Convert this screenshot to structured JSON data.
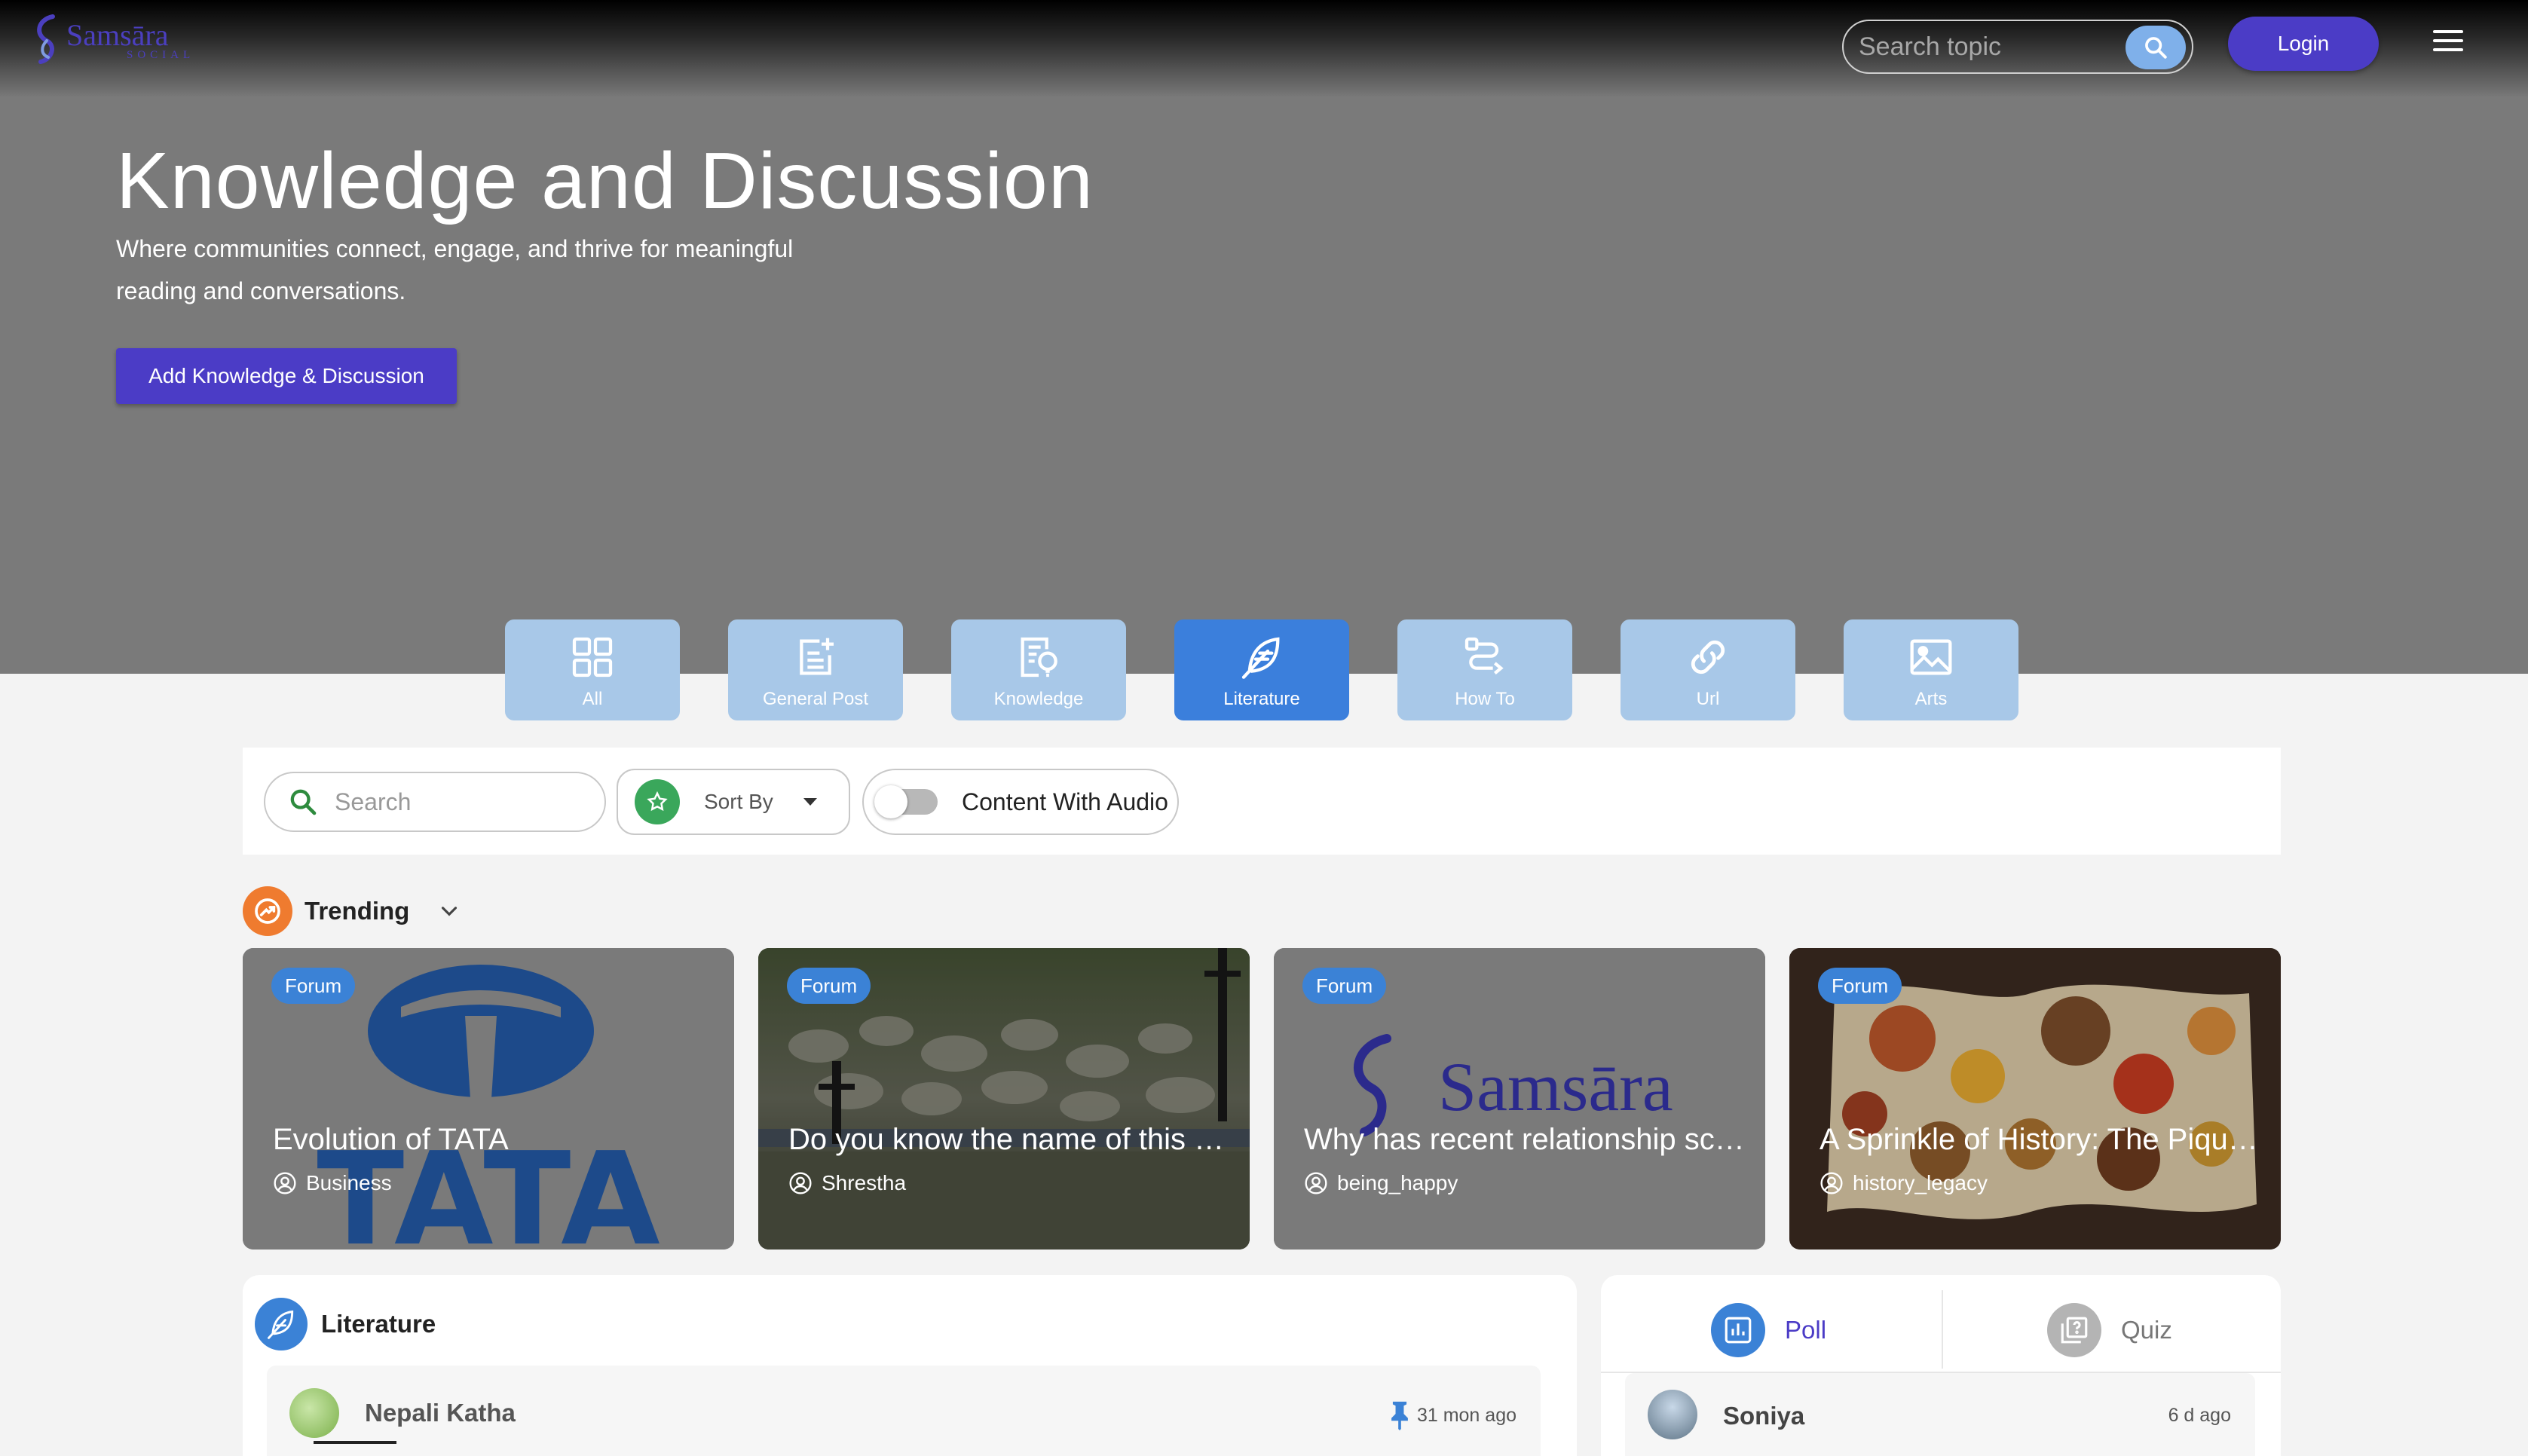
{
  "header": {
    "logo_text": "Samsāra",
    "logo_sub": "SOCIAL",
    "search_placeholder": "Search topic",
    "login_label": "Login"
  },
  "hero": {
    "title": "Knowledge and Discussion",
    "subtitle": "Where communities connect, engage, and thrive for meaningful reading and conversations.",
    "cta_label": "Add Knowledge & Discussion"
  },
  "categories": [
    {
      "label": "All",
      "icon": "grid-icon",
      "active": false
    },
    {
      "label": "General Post",
      "icon": "edit-document-icon",
      "active": false
    },
    {
      "label": "Knowledge",
      "icon": "knowledge-document-icon",
      "active": false
    },
    {
      "label": "Literature",
      "icon": "feather-icon",
      "active": true
    },
    {
      "label": "How To",
      "icon": "route-icon",
      "active": false
    },
    {
      "label": "Url",
      "icon": "link-icon",
      "active": false
    },
    {
      "label": "Arts",
      "icon": "image-icon",
      "active": false
    }
  ],
  "filters": {
    "search_placeholder": "Search",
    "sort_label": "Sort By",
    "audio_label": "Content With Audio",
    "audio_enabled": false
  },
  "trending": {
    "label": "Trending",
    "cards": [
      {
        "badge": "Forum",
        "title": "Evolution of TATA",
        "author": "Business",
        "image": "tata-logo"
      },
      {
        "badge": "Forum",
        "title": "Do you know the name of this …",
        "author": "Shrestha",
        "image": "riverbank-rocks-photo"
      },
      {
        "badge": "Forum",
        "title": "Why has recent relationship sc…",
        "author": "being_happy",
        "image": "samsara-logo"
      },
      {
        "badge": "Forum",
        "title": "A Sprinkle of History: The Piqu…",
        "author": "history_legacy",
        "image": "spice-world-map-photo"
      }
    ]
  },
  "literature": {
    "title": "Literature",
    "post": {
      "author": "Nepali Katha",
      "time": "31 mon ago"
    }
  },
  "poll_quiz": {
    "tabs": [
      {
        "label": "Poll",
        "active": true
      },
      {
        "label": "Quiz",
        "active": false
      }
    ],
    "post": {
      "author": "Soniya",
      "time": "6 d ago"
    }
  },
  "colors": {
    "brand": "#4b3cc6",
    "accent_blue": "#3b7fdc",
    "tab_inactive": "#a8c8e8",
    "trending_orange": "#ef7b2f",
    "sort_green": "#3aa75b"
  }
}
